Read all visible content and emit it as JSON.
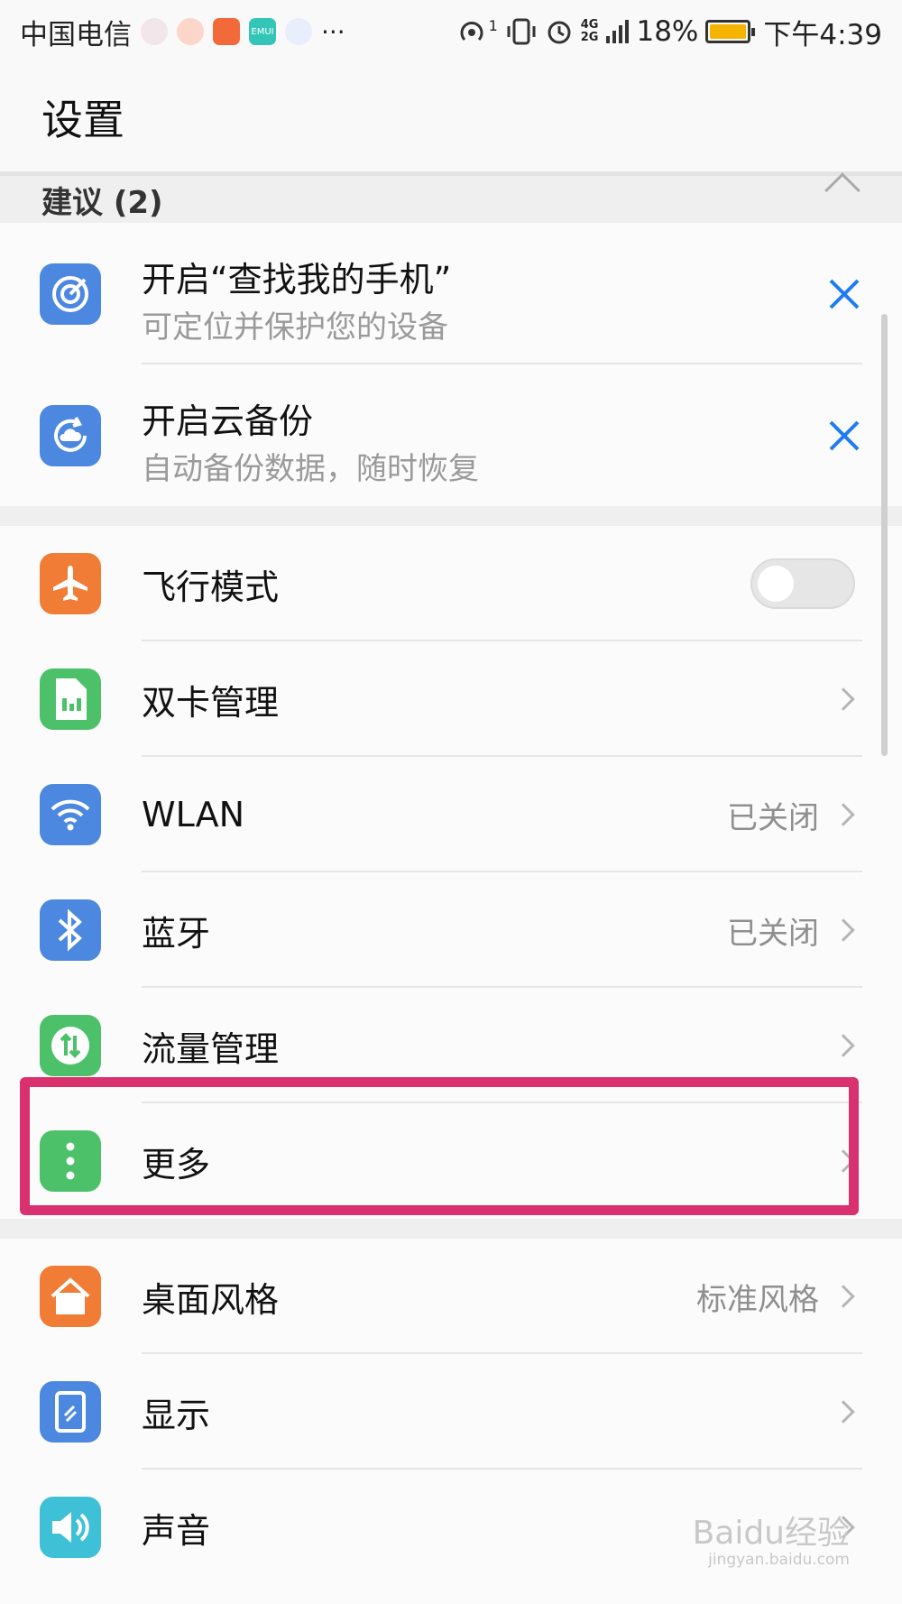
{
  "status_bar": {
    "carrier": "中国电信",
    "more": "···",
    "signal_1": "1",
    "network": "4G",
    "network2": "2G",
    "battery": "18%",
    "time": "下午4:39",
    "emui_badge": "EMUI"
  },
  "header": {
    "title": "设置"
  },
  "suggestions": {
    "header": "建议 (2)",
    "items": [
      {
        "title": "开启“查找我的手机”",
        "subtitle": "可定位并保护您的设备"
      },
      {
        "title": "开启云备份",
        "subtitle": "自动备份数据，随时恢复"
      }
    ]
  },
  "network_section": {
    "items": [
      {
        "label": "飞行模式"
      },
      {
        "label": "双卡管理"
      },
      {
        "label": "WLAN",
        "value": "已关闭"
      },
      {
        "label": "蓝牙",
        "value": "已关闭"
      },
      {
        "label": "流量管理"
      },
      {
        "label": "更多"
      }
    ]
  },
  "display_section": {
    "items": [
      {
        "label": "桌面风格",
        "value": "标准风格"
      },
      {
        "label": "显示"
      },
      {
        "label": "声音"
      }
    ]
  },
  "watermark": {
    "text": "Baidu经验",
    "url": "jingyan.baidu.com"
  },
  "colors": {
    "highlight": "#d9306e",
    "blue": "#4c88e0",
    "orange": "#f07c36",
    "green": "#4cc16a",
    "close_blue": "#1e7cf2"
  }
}
